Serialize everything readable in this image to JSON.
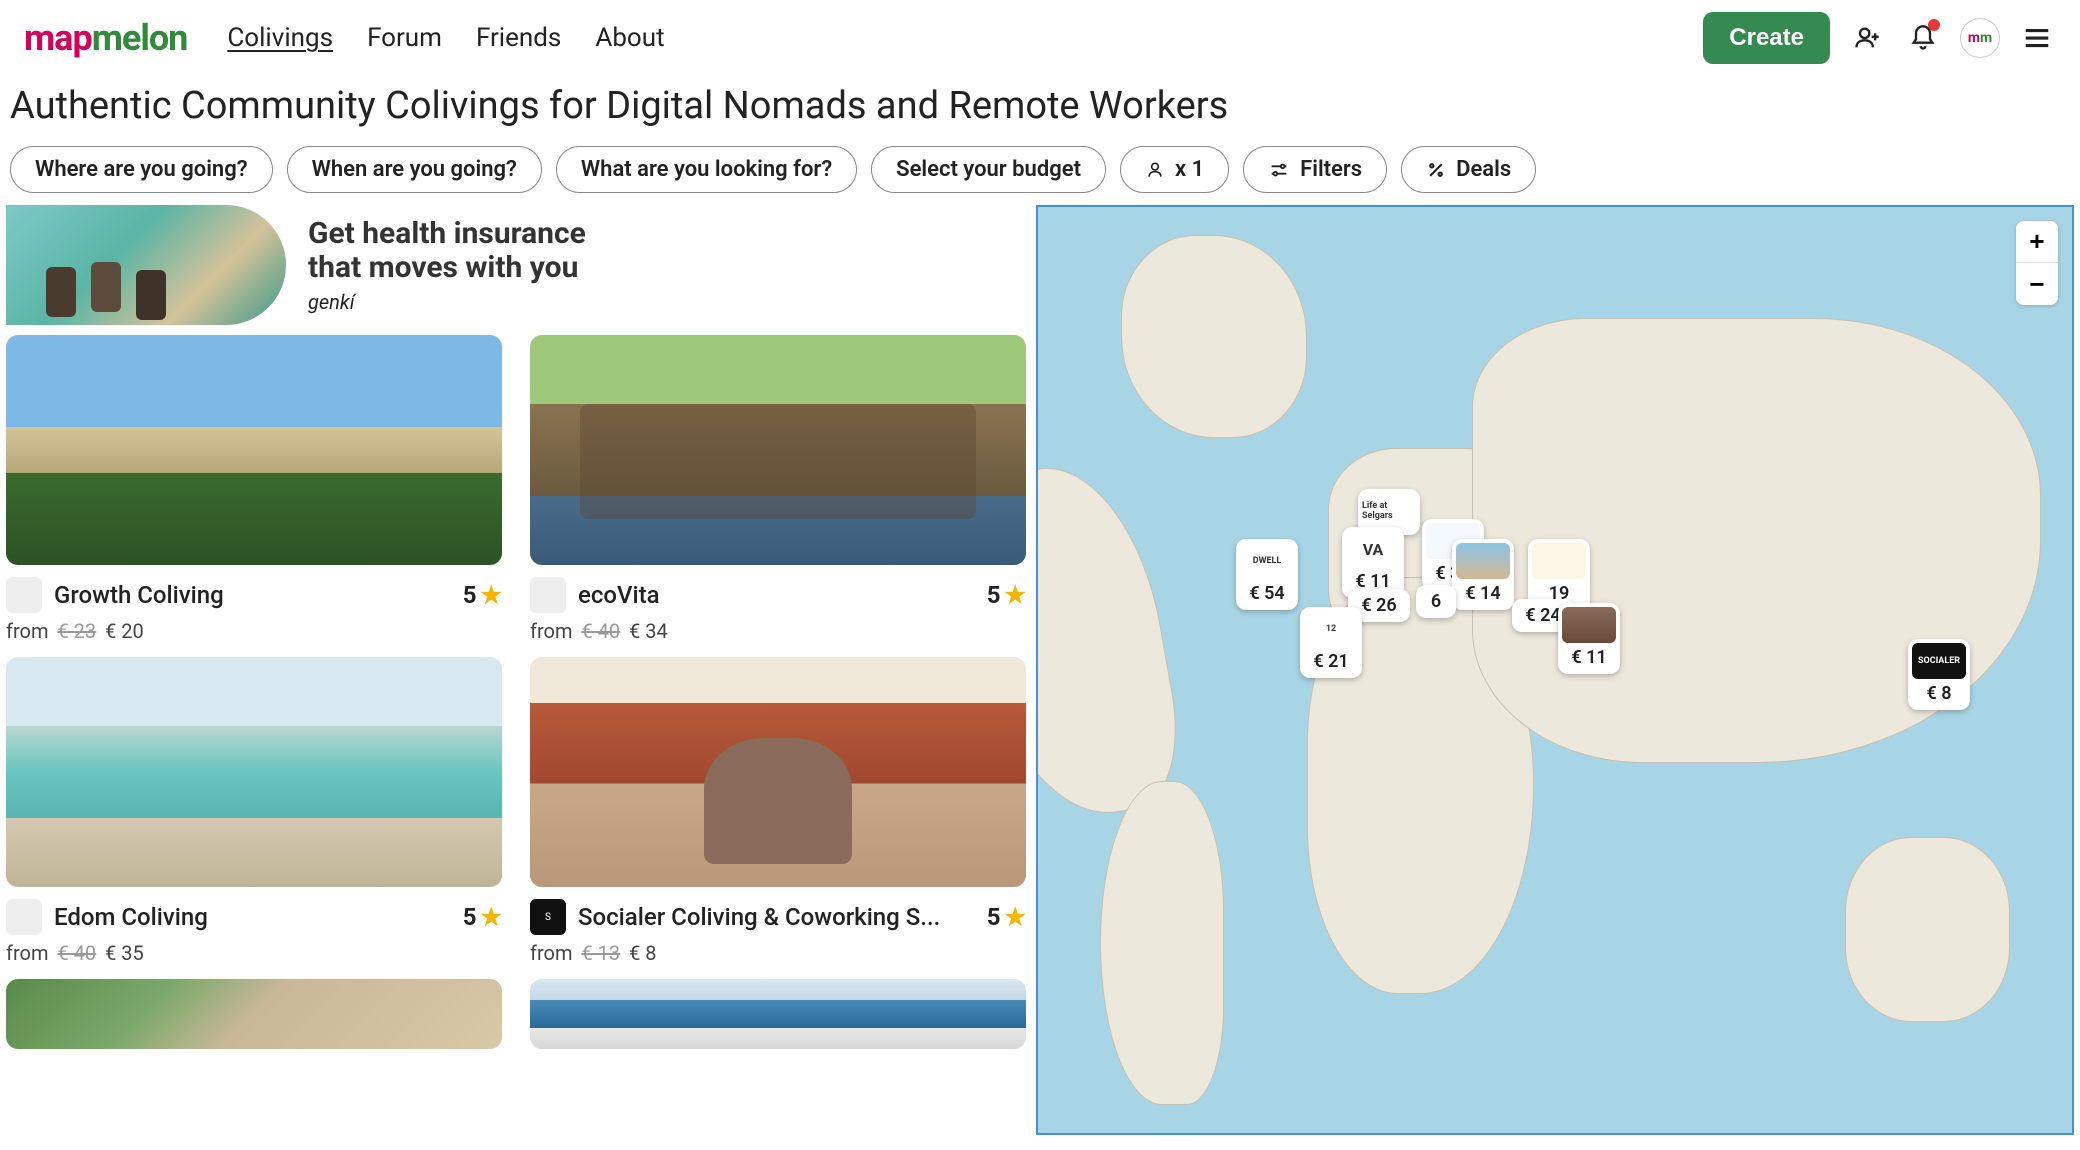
{
  "logo": {
    "part1": "map",
    "part2": "melon"
  },
  "nav": {
    "colivings": "Colivings",
    "forum": "Forum",
    "friends": "Friends",
    "about": "About"
  },
  "header": {
    "create": "Create",
    "avatar_m1": "m",
    "avatar_m2": "m"
  },
  "page_title": "Authentic Community Colivings for Digital Nomads and Remote Workers",
  "filters": {
    "where": "Where are you going?",
    "when": "When are you going?",
    "what": "What are you looking for?",
    "budget": "Select your budget",
    "guests": "x 1",
    "filters_label": "Filters",
    "deals_label": "Deals"
  },
  "promo": {
    "line1": "Get health insurance",
    "line2": "that moves with you",
    "brand": "genkí"
  },
  "listings": [
    {
      "name": "Growth Coliving",
      "rating": "5",
      "from": "from",
      "old_price": "€ 23",
      "price": "€ 20"
    },
    {
      "name": "ecoVita",
      "rating": "5",
      "from": "from",
      "old_price": "€ 40",
      "price": "€ 34"
    },
    {
      "name": "Edom Coliving",
      "rating": "5",
      "from": "from",
      "old_price": "€ 40",
      "price": "€ 35"
    },
    {
      "name": "Socialer Coliving & Coworking S...",
      "rating": "5",
      "from": "from",
      "old_price": "€ 13",
      "price": "€ 8"
    }
  ],
  "map_markers": [
    {
      "label": "Life at Selgars",
      "price": ""
    },
    {
      "label": "",
      "price": "€ 34"
    },
    {
      "label": "DWELL",
      "price": "€ 54"
    },
    {
      "label": "VA",
      "price": "€ 11"
    },
    {
      "label": "",
      "price": "€ 26"
    },
    {
      "label": "",
      "price": "€ 14"
    },
    {
      "label": "",
      "price": "19"
    },
    {
      "label": "12",
      "price": "€ 21"
    },
    {
      "label": "",
      "price": "6"
    },
    {
      "label": "",
      "price": "€ 24"
    },
    {
      "label": "",
      "price": "€ 11"
    },
    {
      "label": "SOCIALER",
      "price": "€ 8"
    }
  ],
  "zoom": {
    "in": "+",
    "out": "−"
  }
}
